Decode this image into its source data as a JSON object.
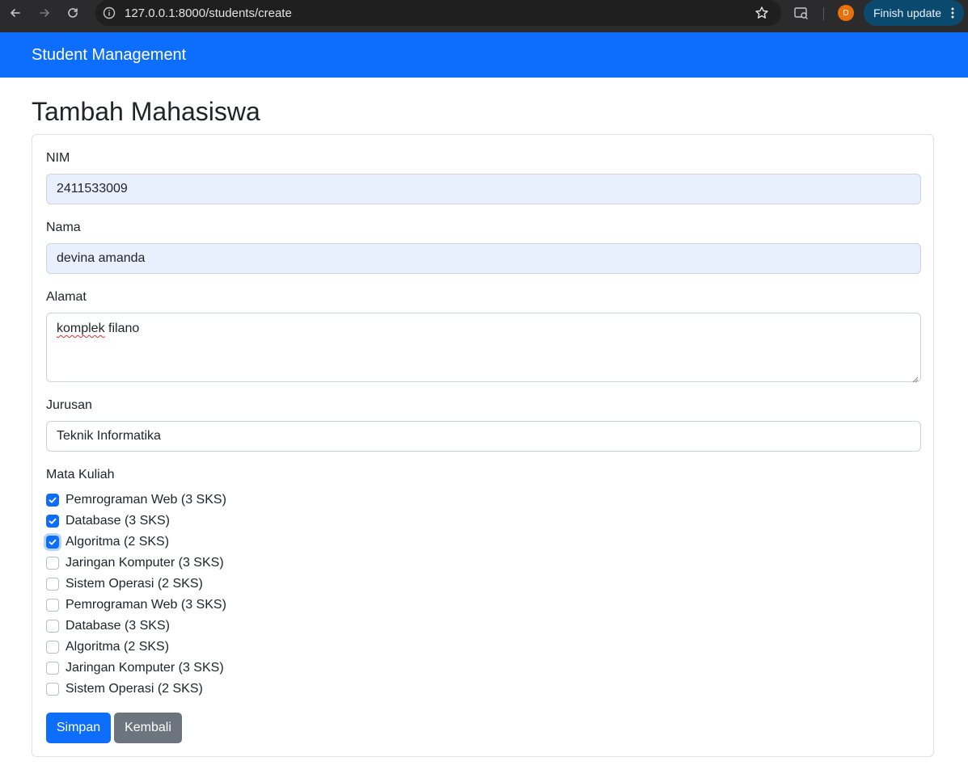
{
  "browser": {
    "url": "127.0.0.1:8000/students/create",
    "profile_initial": "D",
    "update_label": "Finish update"
  },
  "navbar": {
    "brand": "Student Management"
  },
  "page": {
    "title": "Tambah Mahasiswa"
  },
  "form": {
    "nim": {
      "label": "NIM",
      "value": "2411533009"
    },
    "nama": {
      "label": "Nama",
      "value": "devina amanda"
    },
    "alamat": {
      "label": "Alamat",
      "value_word1": "komplek",
      "value_word2": " filano"
    },
    "jurusan": {
      "label": "Jurusan",
      "value": "Teknik Informatika"
    },
    "mata_kuliah": {
      "label": "Mata Kuliah",
      "items": [
        {
          "label": "Pemrograman Web (3 SKS)",
          "checked": true
        },
        {
          "label": "Database (3 SKS)",
          "checked": true
        },
        {
          "label": "Algoritma (2 SKS)",
          "checked": true
        },
        {
          "label": "Jaringan Komputer (3 SKS)",
          "checked": false
        },
        {
          "label": "Sistem Operasi (2 SKS)",
          "checked": false
        },
        {
          "label": "Pemrograman Web (3 SKS)",
          "checked": false
        },
        {
          "label": "Database (3 SKS)",
          "checked": false
        },
        {
          "label": "Algoritma (2 SKS)",
          "checked": false
        },
        {
          "label": "Jaringan Komputer (3 SKS)",
          "checked": false
        },
        {
          "label": "Sistem Operasi (2 SKS)",
          "checked": false
        }
      ]
    },
    "submit_label": "Simpan",
    "back_label": "Kembali"
  },
  "colors": {
    "primary": "#0d6efd",
    "secondary": "#6c757d",
    "autofill": "#e8f0fe"
  }
}
